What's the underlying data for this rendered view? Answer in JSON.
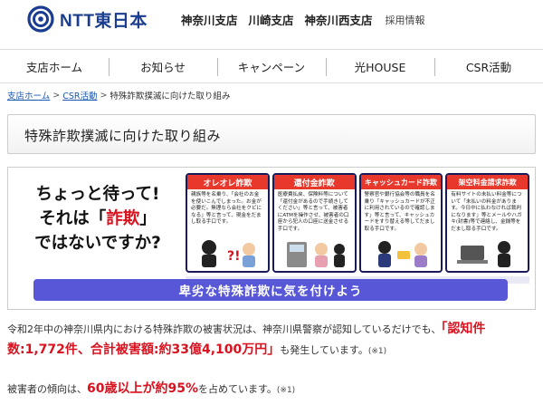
{
  "header": {
    "logo_text": "NTT東日本",
    "branches": [
      "神奈川支店",
      "川崎支店",
      "神奈川西支店"
    ],
    "recruit": "採用情報"
  },
  "nav": {
    "items": [
      "支店ホーム",
      "お知らせ",
      "キャンペーン",
      "光HOUSE",
      "CSR活動"
    ]
  },
  "breadcrumb": {
    "home": "支店ホーム",
    "csr": "CSR活動",
    "current": "特殊詐欺撲滅に向けた取り組み",
    "separator": ">"
  },
  "page": {
    "title": "特殊詐欺撲滅に向けた取り組み"
  },
  "banner": {
    "slogan_line1": "ちょっと待って!",
    "slogan_line2_pre": "それは「",
    "slogan_line2_red": "詐欺",
    "slogan_line2_post": "」",
    "slogan_line3": "ではないですか?",
    "cards": [
      {
        "title": "オレオレ詐欺",
        "color": "#e8382c",
        "body": "親族等を名乗り、「会社のお金を使いこんでしまった。お金が必要だ。無理なら会社をクビになる」等と言って、現金をだまし取る手口です。"
      },
      {
        "title": "還付金詐欺",
        "color": "#e8382c",
        "body": "医療費払戻、保険料等について「還付金があるので手続きしてください」等と言って、被害者にATMを操作させ、被害者の口座から犯人の口座に送金させる手口です。"
      },
      {
        "title": "キャッシュカード詐欺",
        "color": "#e8382c",
        "body": "警察官や銀行協会等の職員を名乗り「キャッシュカードが不正に利用されているので確認します」等と言って、キャッシュカードをすり替える等してだまし取る手口です。"
      },
      {
        "title": "架空料金請求詐欺",
        "color": "#e8382c",
        "body": "有料サイトの未払い料金等について「未払いの料金があります。今日中に払わなければ裁判になります」等とメールやハガキ(封書)等で連絡し、金銭等をだまし取る手口です。"
      }
    ],
    "callout": "卑劣な特殊詐欺に気を付けよう"
  },
  "content": {
    "p1_pre": "令和2年中の神奈川県内における特殊詐欺の被害状況は、神奈川県警察が認知しているだけでも、",
    "p1_hl": "「認知件数:1,772件、合計被害額:約33億4,100万円」",
    "p1_post": "も発生しています。",
    "p1_note": "(※1)",
    "p2_pre": "被害者の傾向は、",
    "p2_hl": "60歳以上が約95%",
    "p2_post": "を占めています。",
    "p2_note": "(※1)"
  },
  "colors": {
    "brand": "#1a3d8f",
    "accent_red": "#d8121f",
    "callout_bg": "#5757d8",
    "link": "#1a55b0"
  }
}
